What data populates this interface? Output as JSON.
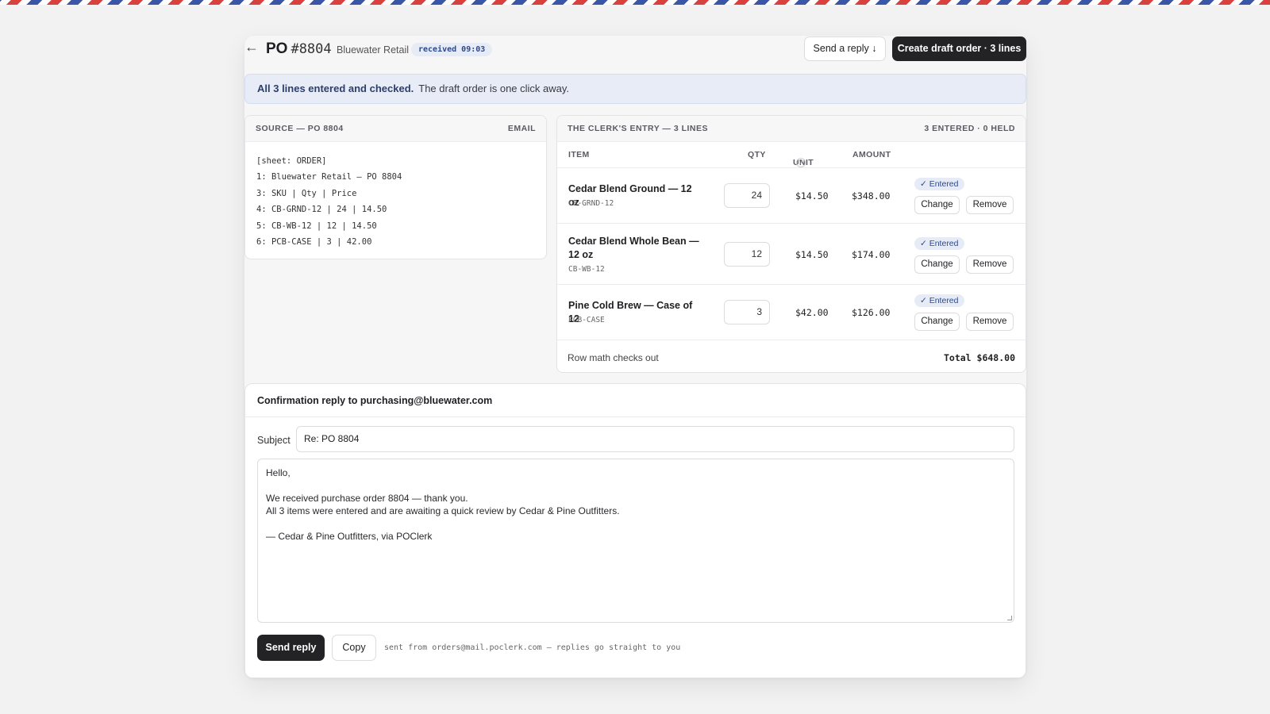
{
  "header": {
    "back_icon": "←",
    "po_prefix": "PO",
    "po_number": "#8804",
    "customer": "Bluewater Retail",
    "received_badge": "received 09:03",
    "send_reply_button": "Send a reply ↓",
    "create_draft_button": "Create draft order · 3 lines"
  },
  "banner": {
    "bold": "All 3 lines entered and checked.",
    "text": "The draft order is one click away."
  },
  "source": {
    "title": "SOURCE — PO 8804",
    "type": "EMAIL",
    "lines": [
      "[sheet: ORDER]",
      "1: Bluewater Retail — PO 8804",
      "3: SKU | Qty | Price",
      "4: CB-GRND-12 | 24 | 14.50",
      "5: CB-WB-12 | 12 | 14.50",
      "6: PCB-CASE | 3 | 42.00"
    ]
  },
  "entry": {
    "title": "THE CLERK'S ENTRY — 3 LINES",
    "status": "3 ENTERED · 0 HELD",
    "columns": {
      "item": "ITEM",
      "qty": "QTY",
      "unit": "UNIT",
      "unit_help": "?",
      "amount": "AMOUNT"
    },
    "rows": [
      {
        "name": "Cedar Blend Ground — 12 oz",
        "sku": "CB-GRND-12",
        "qty": "24",
        "unit": "$14.50",
        "amount": "$348.00",
        "status": "✓ Entered",
        "change": "Change",
        "remove": "Remove"
      },
      {
        "name": "Cedar Blend Whole Bean — 12 oz",
        "sku": "CB-WB-12",
        "qty": "12",
        "unit": "$14.50",
        "amount": "$174.00",
        "status": "✓ Entered",
        "change": "Change",
        "remove": "Remove"
      },
      {
        "name": "Pine Cold Brew — Case of 12",
        "sku": "PCB-CASE",
        "qty": "3",
        "unit": "$42.00",
        "amount": "$126.00",
        "status": "✓ Entered",
        "change": "Change",
        "remove": "Remove"
      }
    ],
    "footer_note": "Row math checks out",
    "total": "Total $648.00"
  },
  "reply": {
    "title": "Confirmation reply to purchasing@bluewater.com",
    "subject_label": "Subject",
    "subject_value": "Re: PO 8804",
    "body": "Hello,\n\nWe received purchase order 8804 — thank you.\nAll 3 items were entered and are awaiting a quick review by Cedar & Pine Outfitters.\n\n— Cedar & Pine Outfitters, via POClerk",
    "send_button": "Send reply",
    "copy_button": "Copy",
    "sent_from": "sent from orders@mail.poclerk.com — replies go straight to you"
  }
}
